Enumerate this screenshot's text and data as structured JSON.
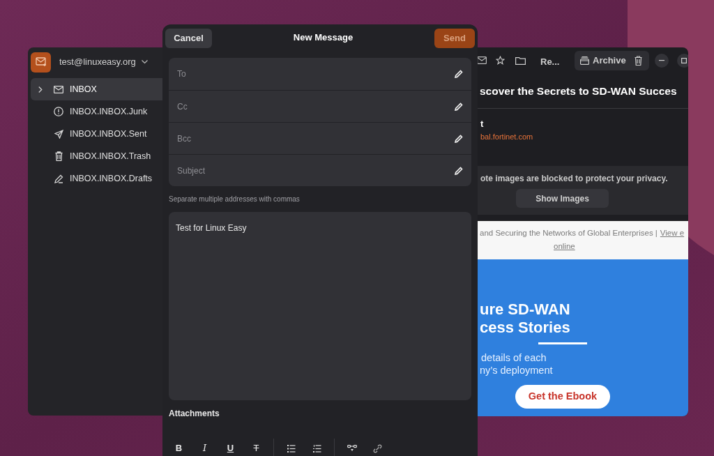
{
  "mail_window": {
    "account": "test@linuxeasy.org",
    "folders": [
      {
        "name": "INBOX",
        "kind": "inbox",
        "selected": true,
        "expandable": true
      },
      {
        "name": "INBOX.INBOX.Junk",
        "kind": "junk",
        "selected": false,
        "expandable": false
      },
      {
        "name": "INBOX.INBOX.Sent",
        "kind": "sent",
        "selected": false,
        "expandable": false
      },
      {
        "name": "INBOX.INBOX.Trash",
        "kind": "trash",
        "selected": false,
        "expandable": false
      },
      {
        "name": "INBOX.INBOX.Drafts",
        "kind": "drafts",
        "selected": false,
        "expandable": false
      }
    ]
  },
  "compose": {
    "cancel": "Cancel",
    "title": "New Message",
    "send": "Send",
    "fields": [
      {
        "placeholder": "To"
      },
      {
        "placeholder": "Cc"
      },
      {
        "placeholder": "Bcc"
      },
      {
        "placeholder": "Subject"
      }
    ],
    "hint": "Separate multiple addresses with commas",
    "body": "Test for Linux Easy",
    "attachments": "Attachments",
    "format_buttons": [
      {
        "kind": "bold",
        "label": "B"
      },
      {
        "kind": "italic",
        "label": "I"
      },
      {
        "kind": "underline",
        "label": "U"
      },
      {
        "kind": "strikethrough",
        "label": "T"
      },
      {
        "kind": "bullet-list"
      },
      {
        "kind": "numbered-list"
      },
      {
        "kind": "separator-line"
      },
      {
        "kind": "link"
      }
    ]
  },
  "reader": {
    "toolbar_title": "Re...",
    "archive": "Archive",
    "subject": "scover the Secrets to SD-WAN Succes",
    "sender_name": "t",
    "sender_email": "bal.fortinet.com",
    "blocked_notice": "ote images are blocked to protect your privacy.",
    "show_images": "Show Images",
    "email": {
      "preheader": "and Securing the Networks of Global Enterprises |",
      "view_link": [
        "View e",
        "online"
      ],
      "headline": [
        "ure SD-WAN",
        "cess Stories"
      ],
      "lines": [
        "details of each",
        "ny’s deployment"
      ],
      "cta": "Get the Ebook"
    }
  }
}
